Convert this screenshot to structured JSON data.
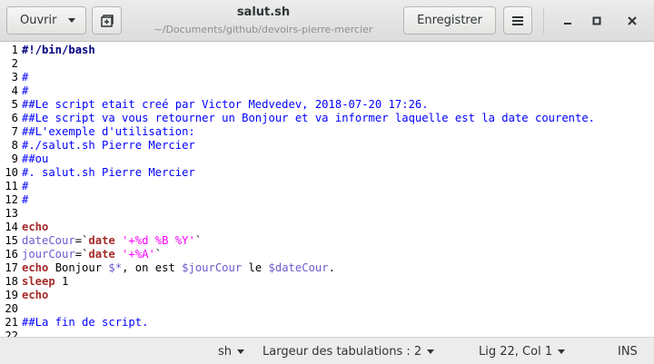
{
  "window": {
    "title": "salut.sh",
    "subtitle": "~/Documents/github/devoirs-pierre-mercier"
  },
  "toolbar": {
    "open_label": "Ouvrir",
    "save_label": "Enregistrer"
  },
  "icons": {
    "open_dropdown": "chevron-down-icon",
    "new_tab": "new-tab-icon",
    "menu": "hamburger-menu-icon",
    "minimize": "minimize-icon",
    "maximize": "maximize-icon",
    "close": "close-icon"
  },
  "editor": {
    "lines": [
      {
        "n": "1",
        "tokens": [
          {
            "c": "sb",
            "t": "#!/bin/bash"
          }
        ]
      },
      {
        "n": "2",
        "tokens": []
      },
      {
        "n": "3",
        "tokens": [
          {
            "c": "cm",
            "t": "#"
          }
        ]
      },
      {
        "n": "4",
        "tokens": [
          {
            "c": "cm",
            "t": "#"
          }
        ]
      },
      {
        "n": "5",
        "tokens": [
          {
            "c": "cm",
            "t": "##Le script etait creé par Victor Medvedev, 2018-07-20 17:26."
          }
        ]
      },
      {
        "n": "6",
        "tokens": [
          {
            "c": "cm",
            "t": "##Le script va vous retourner un Bonjour et va informer laquelle est la date courente."
          }
        ]
      },
      {
        "n": "7",
        "tokens": [
          {
            "c": "cm",
            "t": "##L'exemple d'utilisation:"
          }
        ]
      },
      {
        "n": "8",
        "tokens": [
          {
            "c": "cm",
            "t": "#./salut.sh Pierre Mercier"
          }
        ]
      },
      {
        "n": "9",
        "tokens": [
          {
            "c": "cm",
            "t": "##ou"
          }
        ]
      },
      {
        "n": "10",
        "tokens": [
          {
            "c": "cm",
            "t": "#. salut.sh Pierre Mercier"
          }
        ]
      },
      {
        "n": "11",
        "tokens": [
          {
            "c": "cm",
            "t": "#"
          }
        ]
      },
      {
        "n": "12",
        "tokens": [
          {
            "c": "cm",
            "t": "#"
          }
        ]
      },
      {
        "n": "13",
        "tokens": []
      },
      {
        "n": "14",
        "tokens": [
          {
            "c": "kw",
            "t": "echo"
          }
        ]
      },
      {
        "n": "15",
        "tokens": [
          {
            "c": "var",
            "t": "dateCour"
          },
          {
            "c": "pl",
            "t": "=`"
          },
          {
            "c": "kw",
            "t": "date"
          },
          {
            "c": "pl",
            "t": " "
          },
          {
            "c": "str",
            "t": "'+%d %B %Y'"
          },
          {
            "c": "pl",
            "t": "`"
          }
        ]
      },
      {
        "n": "16",
        "tokens": [
          {
            "c": "var",
            "t": "jourCour"
          },
          {
            "c": "pl",
            "t": "=`"
          },
          {
            "c": "kw",
            "t": "date"
          },
          {
            "c": "pl",
            "t": " "
          },
          {
            "c": "str",
            "t": "'+%A'"
          },
          {
            "c": "pl",
            "t": "`"
          }
        ]
      },
      {
        "n": "17",
        "tokens": [
          {
            "c": "kw",
            "t": "echo"
          },
          {
            "c": "pl",
            "t": " Bonjour "
          },
          {
            "c": "var",
            "t": "$*"
          },
          {
            "c": "pl",
            "t": ", on est "
          },
          {
            "c": "var",
            "t": "$jourCour"
          },
          {
            "c": "pl",
            "t": " le "
          },
          {
            "c": "var",
            "t": "$dateCour"
          },
          {
            "c": "pl",
            "t": "."
          }
        ]
      },
      {
        "n": "18",
        "tokens": [
          {
            "c": "kw",
            "t": "sleep"
          },
          {
            "c": "pl",
            "t": " 1"
          }
        ]
      },
      {
        "n": "19",
        "tokens": [
          {
            "c": "kw",
            "t": "echo"
          }
        ]
      },
      {
        "n": "20",
        "tokens": []
      },
      {
        "n": "21",
        "tokens": [
          {
            "c": "cm",
            "t": "##La fin de script."
          }
        ]
      },
      {
        "n": "22",
        "tokens": []
      }
    ]
  },
  "statusbar": {
    "language": "sh",
    "tab_width": "Largeur des tabulations : 2",
    "cursor_position": "Lig 22, Col 1",
    "insert_mode": "INS"
  }
}
